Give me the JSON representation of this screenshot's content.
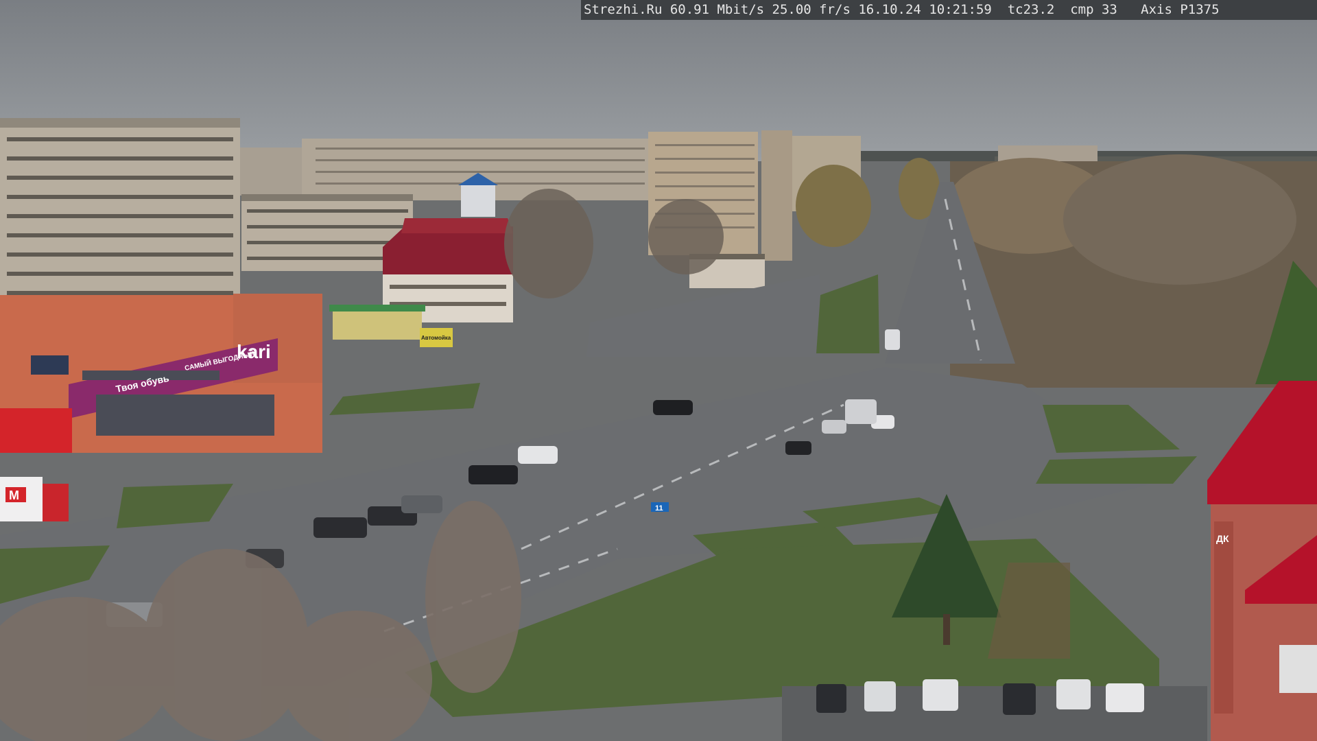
{
  "osd": {
    "text": "Strezhi.Ru 60.91 Mbit/s 25.00 fr/s 16.10.24 10:21:59  tc23.2  cmp 33   Axis P1375"
  },
  "signs": {
    "store_brand": "kari",
    "store_slogan": "Твоя обувь",
    "store_sub": "САМЫЙ ВЫГОДНЫЙ",
    "truck_logo": "M",
    "billboard": "Автомойка",
    "lane_sign": "11",
    "right_building": "ДК"
  },
  "colors": {
    "sky": "#858a8f",
    "road": "#6e7073",
    "grass": "#4f6537",
    "kari_band": "#8a2a6b",
    "roof_red": "#b5122a",
    "osd_bar": "#3d4043"
  }
}
